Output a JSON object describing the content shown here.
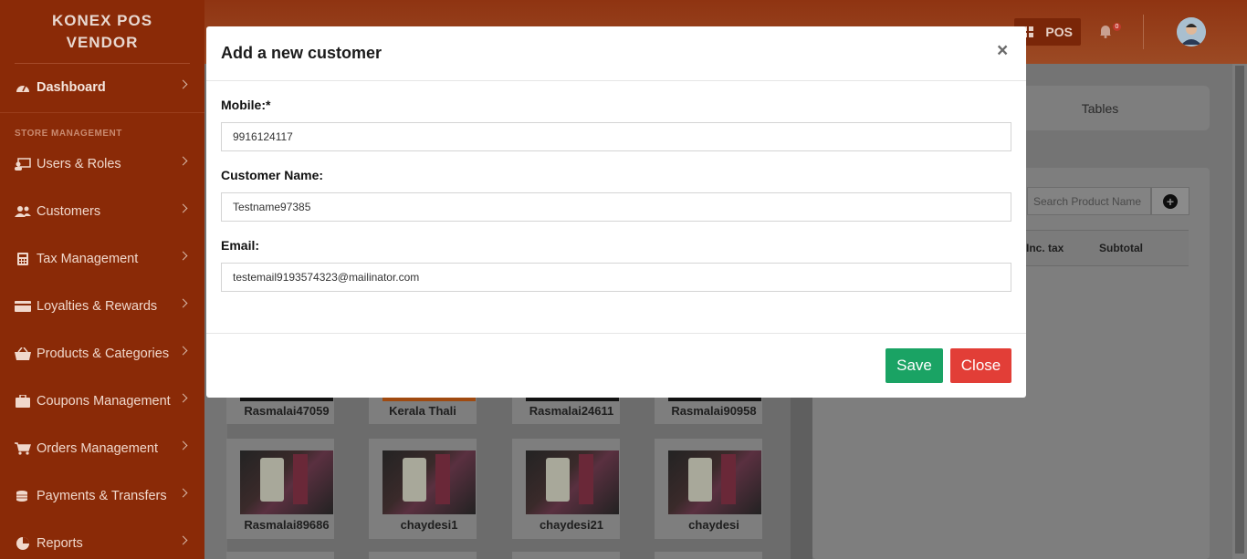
{
  "brand": {
    "line1": "KONEX POS",
    "line2": "VENDOR"
  },
  "sidebar": {
    "dashboard": "Dashboard",
    "section": "STORE MANAGEMENT",
    "items": [
      {
        "label": "Users & Roles",
        "icon": "users-roles-icon"
      },
      {
        "label": "Customers",
        "icon": "customers-icon"
      },
      {
        "label": "Tax Management",
        "icon": "calculator-icon"
      },
      {
        "label": "Loyalties & Rewards",
        "icon": "card-icon"
      },
      {
        "label": "Products & Categories",
        "icon": "basket-icon"
      },
      {
        "label": "Coupons Management",
        "icon": "briefcase-icon"
      },
      {
        "label": "Orders Management",
        "icon": "cart-icon"
      },
      {
        "label": "Payments & Transfers",
        "icon": "coins-icon"
      },
      {
        "label": "Reports",
        "icon": "pie-chart-icon"
      }
    ]
  },
  "header": {
    "pos_label": "POS",
    "notification_count": "0"
  },
  "main": {
    "tables_tab": "Tables",
    "search_placeholder": "Search Product Name",
    "table_headers": [
      "Inc. tax",
      "Subtotal"
    ],
    "products": [
      "Rasmalai47059",
      "Kerala Thali",
      "Rasmalai24611",
      "Rasmalai90958",
      "Rasmalai89686",
      "chaydesi1",
      "chaydesi21",
      "chaydesi"
    ]
  },
  "modal": {
    "title": "Add a new customer",
    "close_symbol": "×",
    "mobile_label": "Mobile:*",
    "mobile_value": "9916124117",
    "name_label": "Customer Name:",
    "name_value": "Testname97385",
    "email_label": "Email:",
    "email_value": "testemail9193574323@mailinator.com",
    "save_label": "Save",
    "close_label": "Close"
  },
  "colors": {
    "sidebar": "#8a2a07",
    "save": "#1aa364",
    "close": "#e23e37"
  }
}
